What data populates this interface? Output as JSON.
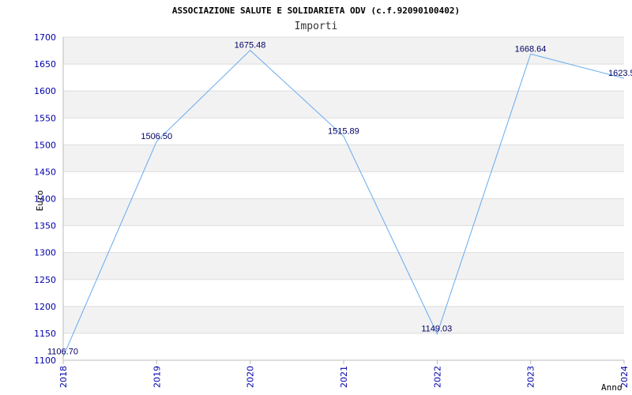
{
  "chart_data": {
    "type": "line",
    "title": "ASSOCIAZIONE SALUTE E SOLIDARIETA ODV (c.f.92090100402)",
    "subtitle": "Importi",
    "xlabel": "Anno",
    "ylabel": "Euro",
    "categories": [
      "2018",
      "2019",
      "2020",
      "2021",
      "2022",
      "2023",
      "2024"
    ],
    "series": [
      {
        "values": [
          1106.7,
          1506.5,
          1675.48,
          1515.89,
          1149.03,
          1668.64,
          1623.5
        ],
        "labels": [
          "1106.70",
          "1506.50",
          "1675.48",
          "1515.89",
          "1149.03",
          "1668.64",
          "1623.5"
        ]
      }
    ],
    "ylim": [
      1100,
      1700
    ],
    "yticks": [
      1100,
      1150,
      1200,
      1250,
      1300,
      1350,
      1400,
      1450,
      1500,
      1550,
      1600,
      1650,
      1700
    ],
    "grid": true,
    "colors": {
      "line": "#66aaee",
      "band": "#f2f2f2",
      "grid": "#dddddd",
      "tick_text": "#0000aa",
      "data_text": "#000066"
    }
  }
}
